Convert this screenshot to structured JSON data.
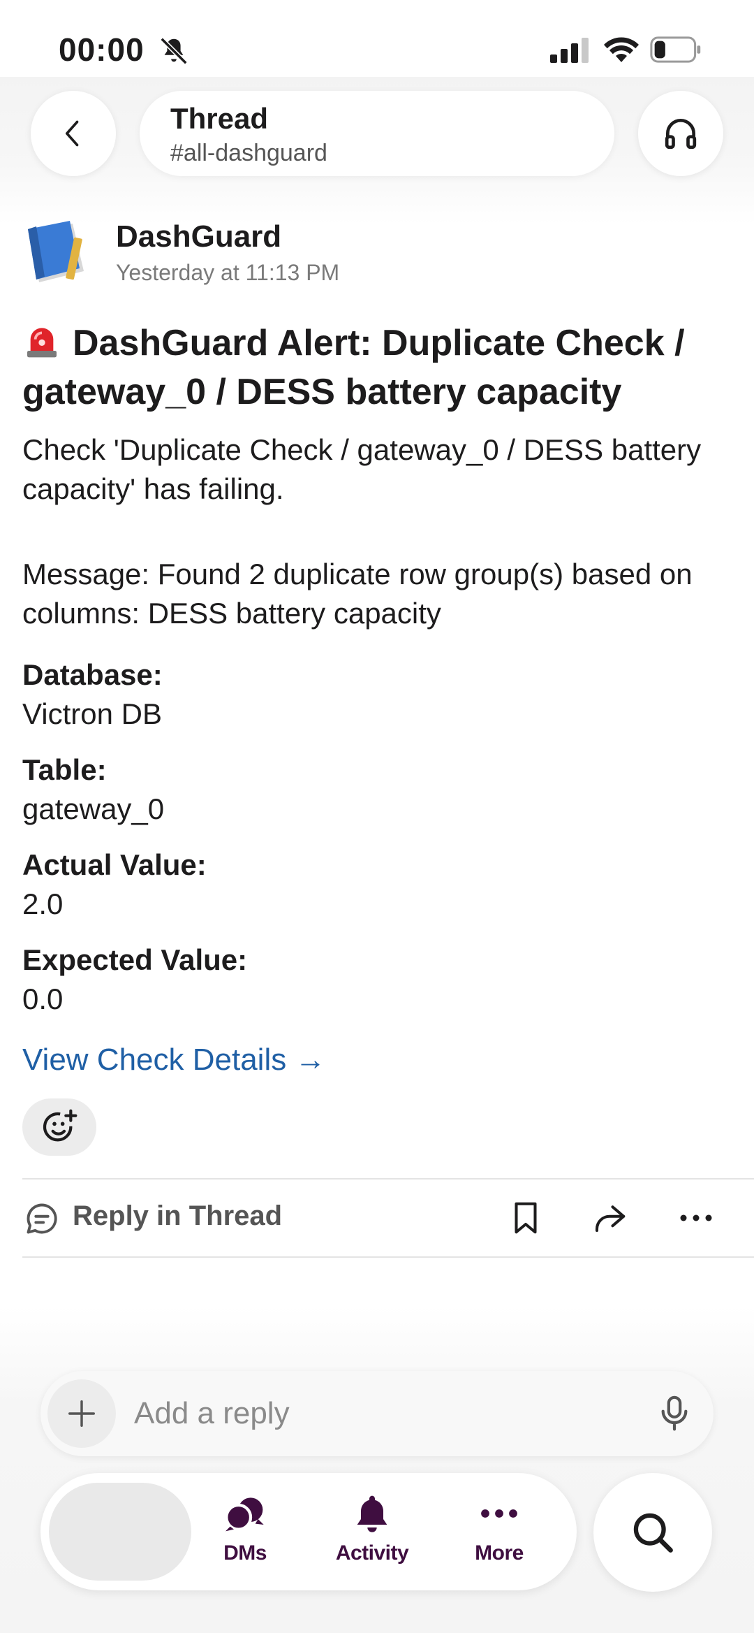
{
  "status_bar": {
    "time": "00:00"
  },
  "header": {
    "title": "Thread",
    "channel": "#all-dashguard"
  },
  "message": {
    "sender": "DashGuard",
    "timestamp": "Yesterday at 11:13 PM",
    "alert_title": "DashGuard Alert: Duplicate Check / gateway_0 / DESS battery capacity",
    "body_line1": "Check 'Duplicate Check / gateway_0 / DESS battery capacity' has failing.",
    "body_line2": "Message: Found 2 duplicate row group(s) based on columns: DESS battery capacity",
    "fields": [
      {
        "label": "Database:",
        "value": "Victron DB"
      },
      {
        "label": "Table:",
        "value": "gateway_0"
      },
      {
        "label": "Actual Value:",
        "value": "2.0"
      },
      {
        "label": "Expected Value:",
        "value": "0.0"
      }
    ],
    "link_text": "View Check Details →"
  },
  "actions": {
    "reply_in_thread": "Reply in Thread"
  },
  "composer": {
    "placeholder": "Add a reply"
  },
  "tabbar": {
    "tabs": [
      {
        "label": "DMs"
      },
      {
        "label": "Activity"
      },
      {
        "label": "More"
      }
    ]
  },
  "colors": {
    "link": "#1f5fa5",
    "brand_aubergine": "#3f0e40",
    "text": "#1d1c1d"
  },
  "icons": [
    "bell-off-icon",
    "signal-icon",
    "wifi-icon",
    "battery-icon",
    "back-chevron-icon",
    "headphones-icon",
    "siren-icon",
    "add-reaction-icon",
    "reply-thread-icon",
    "bookmark-icon",
    "share-icon",
    "more-icon",
    "plus-icon",
    "microphone-icon",
    "dms-icon",
    "activity-bell-icon",
    "more-dots-icon",
    "search-icon"
  ]
}
